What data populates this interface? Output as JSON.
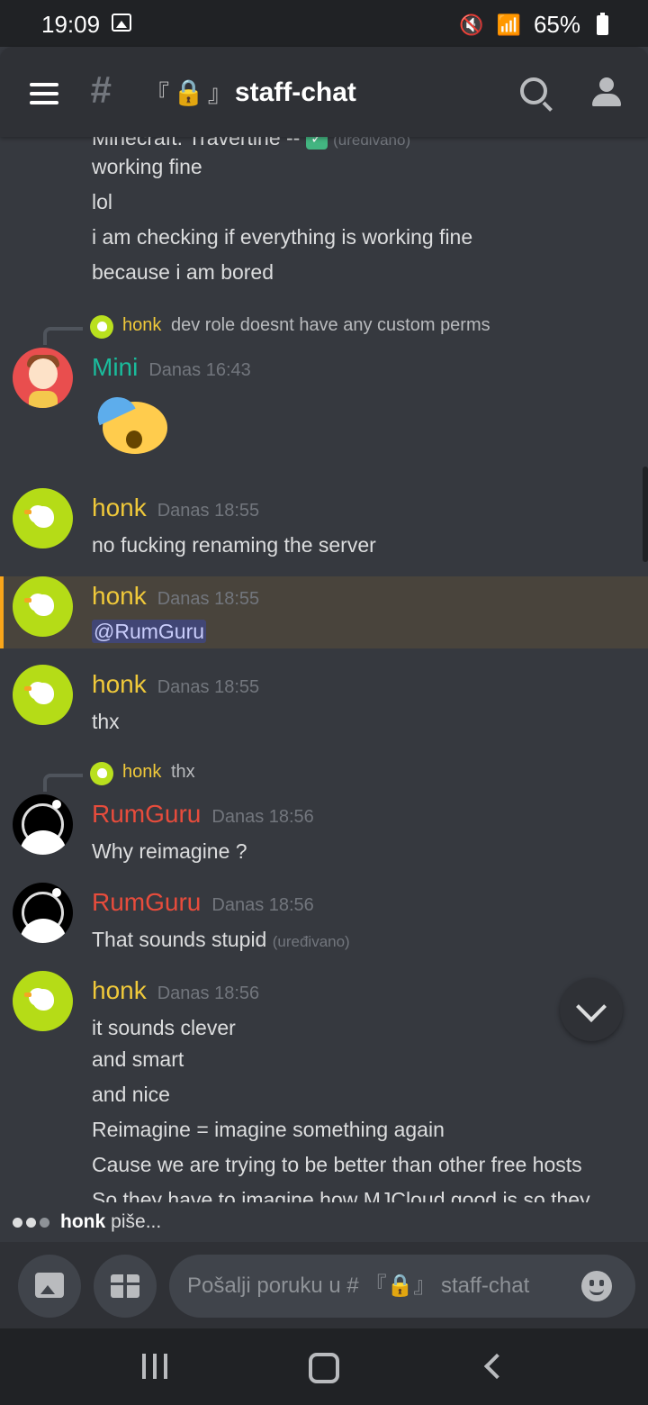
{
  "status_bar": {
    "time": "19:09",
    "battery": "65%"
  },
  "header": {
    "channel_prefix": "『",
    "channel_lock": "🔒",
    "channel_suffix": "』",
    "channel_name": "staff-chat"
  },
  "messages": {
    "cut_line": "Minecraft: Travertine -- ",
    "cut_edited": "(uređivano)",
    "continued": [
      "working fine",
      "lol",
      "i am checking if everything is working fine",
      "because i am bored"
    ],
    "reply1": {
      "name": "honk",
      "text": "dev role doesnt have any custom perms"
    },
    "mini": {
      "name": "Mini",
      "time": "Danas 16:43"
    },
    "honk1": {
      "name": "honk",
      "time": "Danas 18:55",
      "text": "no fucking renaming the server"
    },
    "honk2": {
      "name": "honk",
      "time": "Danas 18:55",
      "mention": "@RumGuru"
    },
    "honk3": {
      "name": "honk",
      "time": "Danas 18:55",
      "text": "thx"
    },
    "reply2": {
      "name": "honk",
      "text": "thx"
    },
    "rum1": {
      "name": "RumGuru",
      "time": "Danas 18:56",
      "text": "Why reimagine ?"
    },
    "rum2": {
      "name": "RumGuru",
      "time": "Danas 18:56",
      "text": "That sounds stupid",
      "edited": "(uređivano)"
    },
    "honk4": {
      "name": "honk",
      "time": "Danas 18:56",
      "lines": [
        "it sounds clever",
        "and smart",
        "and nice",
        "Reimagine = imagine something again",
        "Cause we are trying to be better than other free hosts",
        "So they have to imagine how MJCloud good is so they"
      ]
    }
  },
  "typing": {
    "name": "honk",
    "text": "piše..."
  },
  "composer": {
    "placeholder": "Pošalji poruku u # 『🔒』 staff-chat"
  },
  "colors": {
    "honk": "#f0c93a",
    "mini": "#1abc9c",
    "rumguru": "#e74c3c",
    "highlight_border": "#faa61a"
  }
}
